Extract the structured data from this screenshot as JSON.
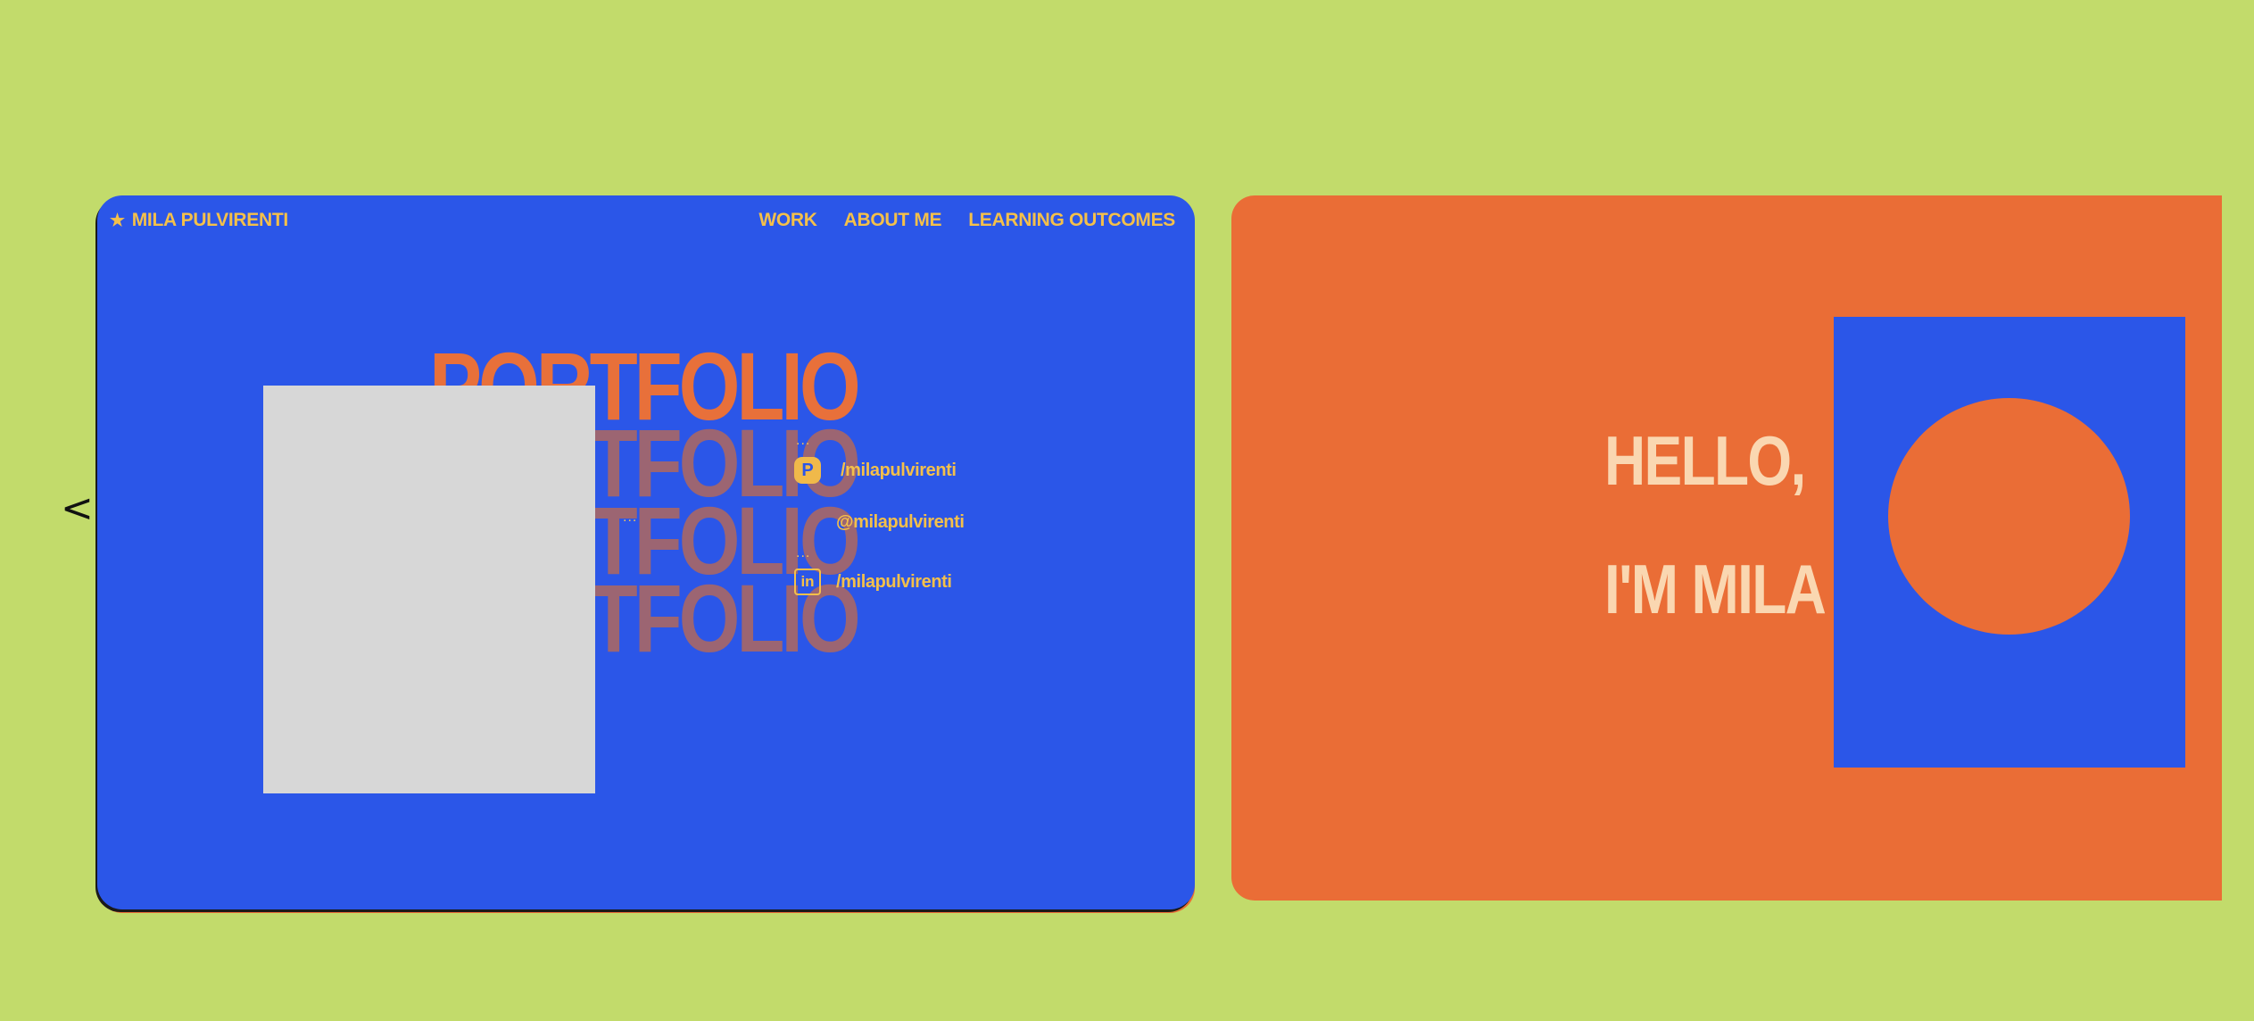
{
  "navigation": {
    "prev_label": "<",
    "next_label": ">"
  },
  "slide_portfolio": {
    "brand": {
      "icon": "star-icon",
      "icon_glyph": "★",
      "name": "MILA PULVIRENTI"
    },
    "nav_links": [
      "WORK",
      "ABOUT ME",
      "LEARNING OUTCOMES"
    ],
    "title": "PORTFOLIO",
    "title_ghosts": [
      "PORTFOLIO",
      "PORTFOLIO",
      "PORTFOLIO"
    ],
    "dots": "...",
    "socials": [
      {
        "icon": "pinterest-icon",
        "icon_glyph": "P",
        "label": "/milapulvirenti"
      },
      {
        "icon": "instagram-icon",
        "icon_glyph": "",
        "label": "@milapulvirenti"
      },
      {
        "icon": "linkedin-icon",
        "icon_glyph": "in",
        "label": "/milapulvirenti"
      }
    ],
    "colors": {
      "background": "#2b56e8",
      "accent": "#e8703a",
      "text": "#f4c04a"
    }
  },
  "slide_hello": {
    "line1": "HELLO,",
    "line2": "I'M MILA",
    "colors": {
      "background": "#ea6d36",
      "panel": "#2b56e8",
      "text": "#fad7b1"
    }
  },
  "page": {
    "background": "#c2db6b"
  }
}
